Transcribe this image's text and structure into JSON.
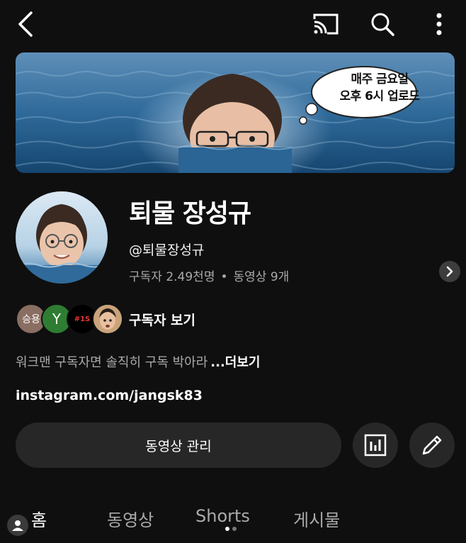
{
  "banner": {
    "bubble_line1": "매주 금요일",
    "bubble_line2": "오후 6시 업로드"
  },
  "channel": {
    "name": "퇴물 장성규",
    "handle": "@퇴물장성규",
    "subscribers": "구독자 2.49천명",
    "separator": "•",
    "videos": "동영상 9개"
  },
  "subscribers_row": {
    "avatars": [
      "승용",
      "Y",
      "#1S",
      ""
    ],
    "label": "구독자 보기"
  },
  "description": {
    "text": "워크맨 구독자면 솔직히 구독 박아라",
    "more": "...더보기"
  },
  "link": "instagram.com/jangsk83",
  "actions": {
    "manage_videos": "동영상 관리"
  },
  "tabs": [
    {
      "label": "홈",
      "active": true
    },
    {
      "label": "동영상",
      "active": false
    },
    {
      "label": "Shorts",
      "active": false
    },
    {
      "label": "게시물",
      "active": false
    }
  ],
  "icons": [
    "back-arrow-icon",
    "cast-icon",
    "search-icon",
    "more-vertical-icon",
    "chevron-right-icon",
    "analytics-icon",
    "edit-pencil-icon",
    "profile-icon"
  ],
  "colors": {
    "background": "#0f0f0f",
    "button_bg": "#272727",
    "text_primary": "#f1f1f1",
    "text_secondary": "#aaaaaa"
  }
}
